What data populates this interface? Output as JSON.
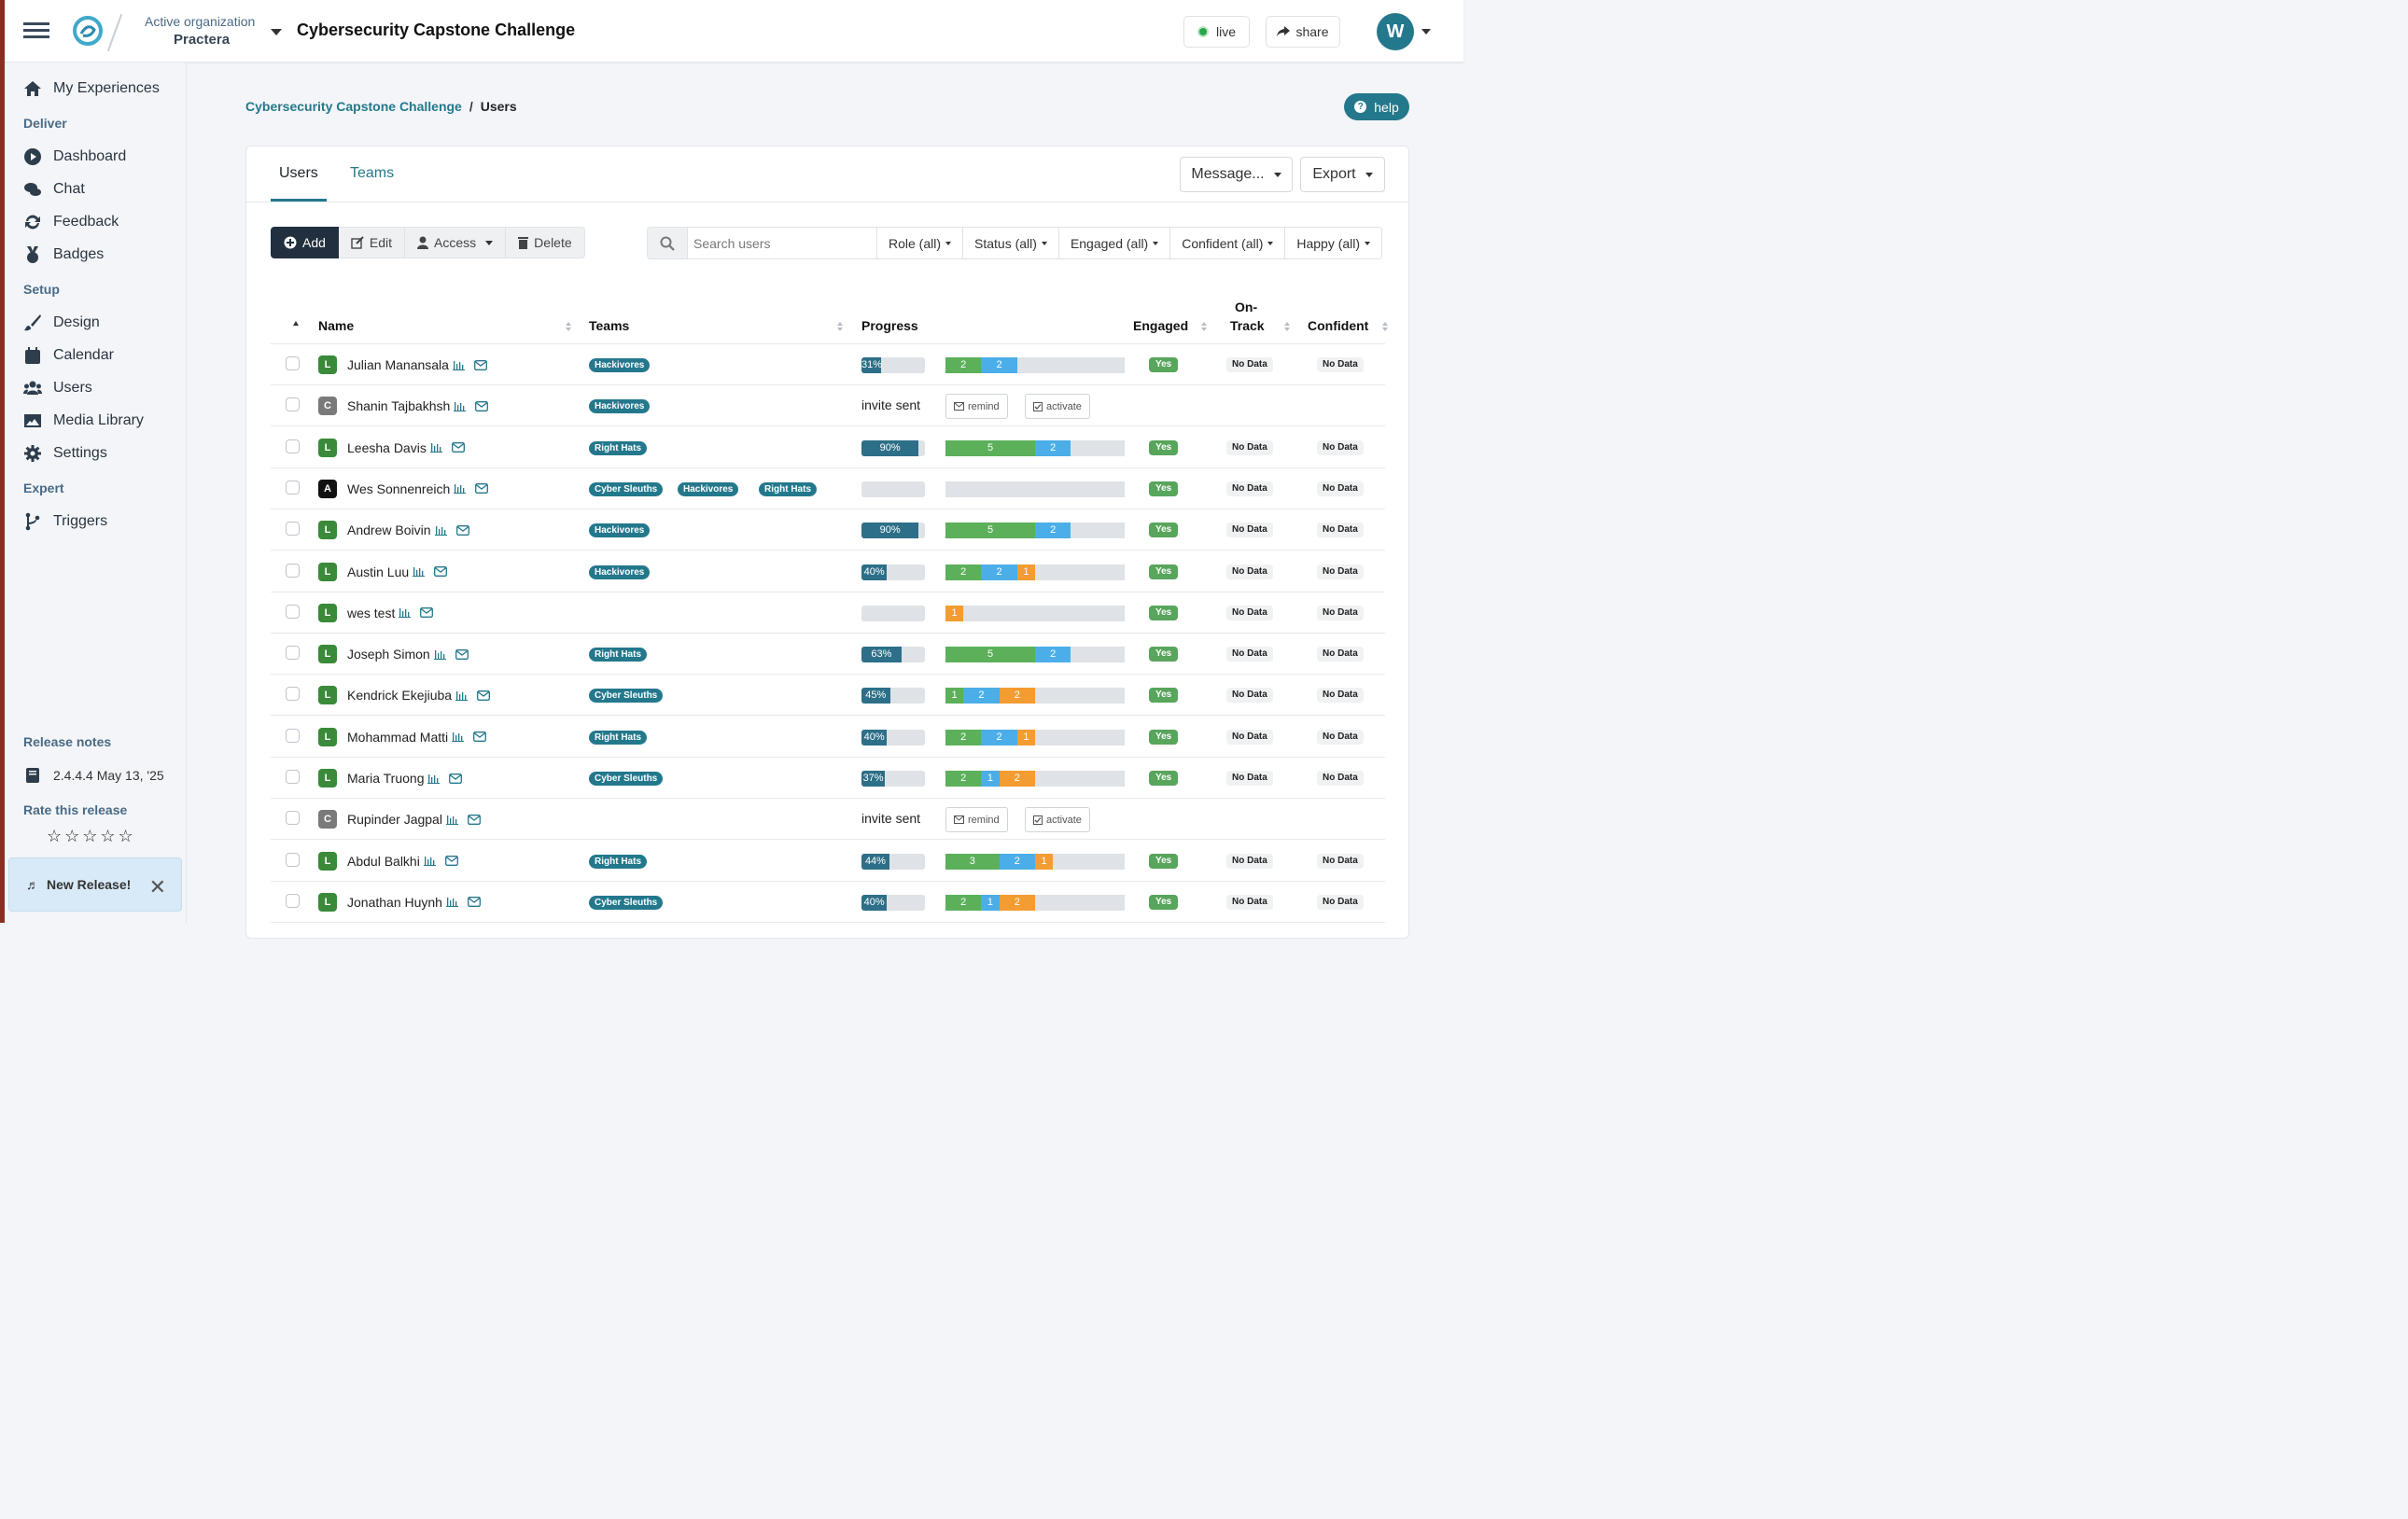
{
  "header": {
    "org_label": "Active organization",
    "org_name": "Practera",
    "title": "Cybersecurity Capstone Challenge",
    "live_label": "live",
    "share_label": "share",
    "avatar_initial": "W"
  },
  "sidebar": {
    "my_experiences": "My Experiences",
    "deliver_heading": "Deliver",
    "deliver": [
      "Dashboard",
      "Chat",
      "Feedback",
      "Badges"
    ],
    "setup_heading": "Setup",
    "setup": [
      "Design",
      "Calendar",
      "Users",
      "Media Library",
      "Settings"
    ],
    "expert_heading": "Expert",
    "expert": [
      "Triggers"
    ],
    "release_notes": "Release notes",
    "version": "2.4.4.4 May 13, '25",
    "rate_label": "Rate this release",
    "stars": "☆☆☆☆☆",
    "new_release": "New Release!"
  },
  "breadcrumb": {
    "parent": "Cybersecurity Capstone Challenge",
    "sep": "/",
    "current": "Users"
  },
  "help_label": "help",
  "tabs": {
    "users": "Users",
    "teams": "Teams"
  },
  "actions": {
    "message": "Message...",
    "export": "Export"
  },
  "toolbar": {
    "add": "Add",
    "edit": "Edit",
    "access": "Access",
    "delete": "Delete"
  },
  "search": {
    "placeholder": "Search users"
  },
  "filters": {
    "role": "Role (all)",
    "status": "Status (all)",
    "engaged": "Engaged (all)",
    "confident": "Confident (all)",
    "happy": "Happy (all)"
  },
  "columns": {
    "name": "Name",
    "teams": "Teams",
    "progress": "Progress",
    "engaged": "Engaged",
    "on_track_1": "On-",
    "on_track_2": "Track",
    "confident": "Confident"
  },
  "colors": {
    "accent": "#24788c",
    "learner": "#3a8a3a",
    "coordinator": "#7a7a7a",
    "admin": "#111111",
    "green": "#5cb05a",
    "blue": "#4baee8",
    "orange": "#f39c32"
  },
  "users": [
    {
      "role": "L",
      "name": "Julian Manansala",
      "teams": [
        "Hackivores"
      ],
      "progress": 31,
      "progress_label": "31%",
      "segments": [
        [
          "g",
          2
        ],
        [
          "b",
          2
        ]
      ],
      "engaged": "Yes",
      "on_track": "No Data",
      "confident": "No Data"
    },
    {
      "role": "C",
      "name": "Shanin Tajbakhsh",
      "teams": [
        "Hackivores"
      ],
      "invite": "invite sent",
      "remind": "remind",
      "activate": "activate"
    },
    {
      "role": "L",
      "name": "Leesha Davis",
      "teams": [
        "Right Hats"
      ],
      "progress": 90,
      "progress_label": "90%",
      "segments": [
        [
          "g",
          5
        ],
        [
          "b",
          2
        ]
      ],
      "engaged": "Yes",
      "on_track": "No Data",
      "confident": "No Data"
    },
    {
      "role": "A",
      "name": "Wes Sonnenreich",
      "teams": [
        "Cyber Sleuths",
        "Hackivores",
        "Right Hats"
      ],
      "progress": 0,
      "progress_label": "",
      "segments": [],
      "engaged": "Yes",
      "on_track": "No Data",
      "confident": "No Data"
    },
    {
      "role": "L",
      "name": "Andrew Boivin",
      "teams": [
        "Hackivores"
      ],
      "progress": 90,
      "progress_label": "90%",
      "segments": [
        [
          "g",
          5
        ],
        [
          "b",
          2
        ]
      ],
      "engaged": "Yes",
      "on_track": "No Data",
      "confident": "No Data"
    },
    {
      "role": "L",
      "name": "Austin Luu",
      "teams": [
        "Hackivores"
      ],
      "progress": 40,
      "progress_label": "40%",
      "segments": [
        [
          "g",
          2
        ],
        [
          "b",
          2
        ],
        [
          "o",
          1
        ]
      ],
      "engaged": "Yes",
      "on_track": "No Data",
      "confident": "No Data"
    },
    {
      "role": "L",
      "name": "wes test",
      "teams": [],
      "progress": 0,
      "progress_label": "",
      "segments": [
        [
          "o",
          1
        ]
      ],
      "engaged": "Yes",
      "on_track": "No Data",
      "confident": "No Data"
    },
    {
      "role": "L",
      "name": "Joseph Simon",
      "teams": [
        "Right Hats"
      ],
      "progress": 63,
      "progress_label": "63%",
      "segments": [
        [
          "g",
          5
        ],
        [
          "b",
          2
        ]
      ],
      "engaged": "Yes",
      "on_track": "No Data",
      "confident": "No Data"
    },
    {
      "role": "L",
      "name": "Kendrick Ekejiuba",
      "teams": [
        "Cyber Sleuths"
      ],
      "progress": 45,
      "progress_label": "45%",
      "segments": [
        [
          "g",
          1
        ],
        [
          "b",
          2
        ],
        [
          "o",
          2
        ]
      ],
      "engaged": "Yes",
      "on_track": "No Data",
      "confident": "No Data"
    },
    {
      "role": "L",
      "name": "Mohammad Matti",
      "teams": [
        "Right Hats"
      ],
      "progress": 40,
      "progress_label": "40%",
      "segments": [
        [
          "g",
          2
        ],
        [
          "b",
          2
        ],
        [
          "o",
          1
        ]
      ],
      "engaged": "Yes",
      "on_track": "No Data",
      "confident": "No Data"
    },
    {
      "role": "L",
      "name": "Maria Truong",
      "teams": [
        "Cyber Sleuths"
      ],
      "progress": 37,
      "progress_label": "37%",
      "segments": [
        [
          "g",
          2
        ],
        [
          "b",
          1
        ],
        [
          "o",
          2
        ]
      ],
      "engaged": "Yes",
      "on_track": "No Data",
      "confident": "No Data"
    },
    {
      "role": "C",
      "name": "Rupinder Jagpal",
      "teams": [],
      "invite": "invite sent",
      "remind": "remind",
      "activate": "activate"
    },
    {
      "role": "L",
      "name": "Abdul Balkhi",
      "teams": [
        "Right Hats"
      ],
      "progress": 44,
      "progress_label": "44%",
      "segments": [
        [
          "g",
          3
        ],
        [
          "b",
          2
        ],
        [
          "o",
          1
        ]
      ],
      "engaged": "Yes",
      "on_track": "No Data",
      "confident": "No Data"
    },
    {
      "role": "L",
      "name": "Jonathan Huynh",
      "teams": [
        "Cyber Sleuths"
      ],
      "progress": 40,
      "progress_label": "40%",
      "segments": [
        [
          "g",
          2
        ],
        [
          "b",
          1
        ],
        [
          "o",
          2
        ]
      ],
      "engaged": "Yes",
      "on_track": "No Data",
      "confident": "No Data"
    }
  ]
}
